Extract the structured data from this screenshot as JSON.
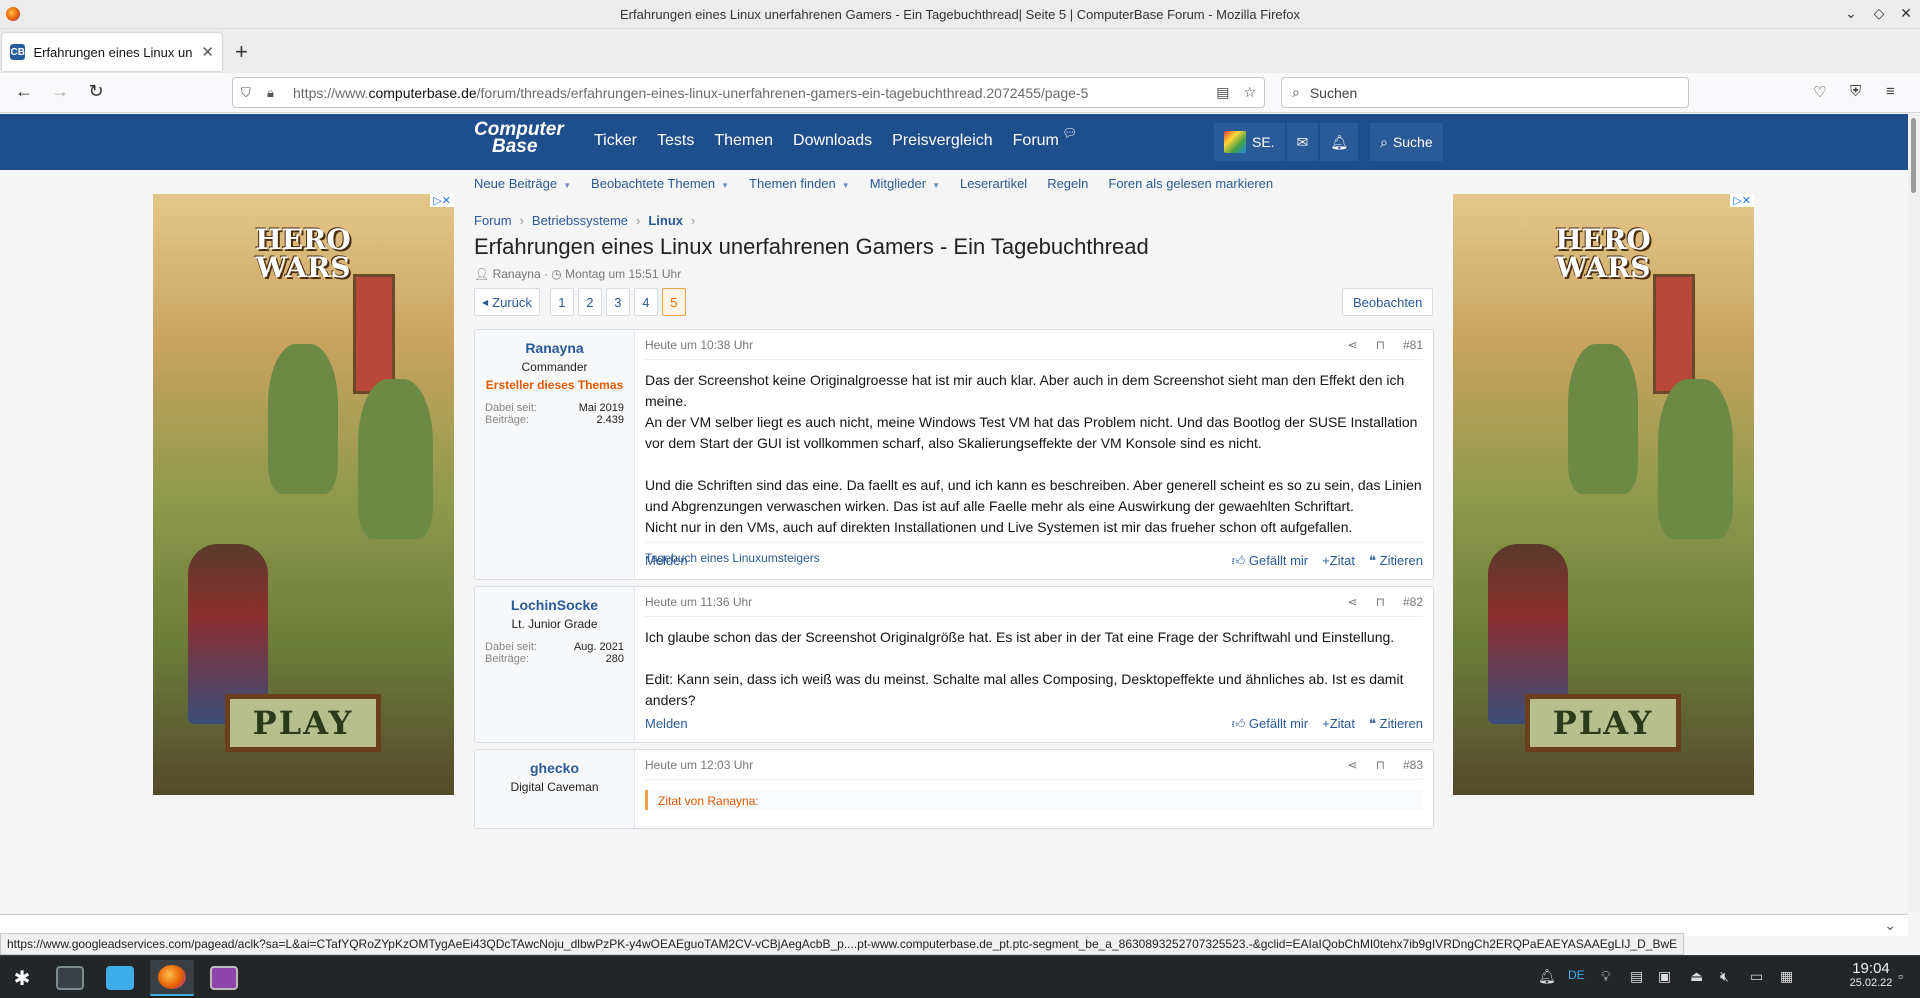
{
  "window": {
    "title": "Erfahrungen eines Linux unerfahrenen Gamers - Ein Tagebuchthread| Seite 5 | ComputerBase Forum - Mozilla Firefox",
    "controls": [
      "⌄",
      "◇",
      "✕"
    ]
  },
  "tab": {
    "label": "Erfahrungen eines Linux un",
    "favicon": "CB"
  },
  "nav": {
    "url_prefix": "https://www.",
    "url_host": "computerbase.de",
    "url_path": "/forum/threads/erfahrungen-eines-linux-unerfahrenen-gamers-ein-tagebuchthread.2072455/page-5",
    "search_placeholder": "Suchen"
  },
  "site": {
    "logo_line1": "Computer",
    "logo_line2": "Base",
    "main_nav": [
      "Ticker",
      "Tests",
      "Themen",
      "Downloads",
      "Preisvergleich",
      "Forum"
    ],
    "user_short": "SE.",
    "search_label": "Suche",
    "sub_nav": [
      {
        "label": "Neue Beiträge",
        "dropdown": true
      },
      {
        "label": "Beobachtete Themen",
        "dropdown": true
      },
      {
        "label": "Themen finden",
        "dropdown": true
      },
      {
        "label": "Mitglieder",
        "dropdown": true
      },
      {
        "label": "Leserartikel",
        "dropdown": false
      },
      {
        "label": "Regeln",
        "dropdown": false
      },
      {
        "label": "Foren als gelesen markieren",
        "dropdown": false
      }
    ]
  },
  "ad": {
    "title_line1": "HERO",
    "title_line2": "WARS",
    "cta": "PLAY"
  },
  "breadcrumb": [
    "Forum",
    "Betriebssysteme",
    "Linux"
  ],
  "thread": {
    "title": "Erfahrungen eines Linux unerfahrenen Gamers - Ein Tagebuchthread",
    "author": "Ranayna",
    "date": "Montag um 15:51 Uhr",
    "back_label": "Zurück",
    "pages": [
      "1",
      "2",
      "3",
      "4",
      "5"
    ],
    "current_page": "5",
    "watch_label": "Beobachten"
  },
  "posts": [
    {
      "user": "Ranayna",
      "rank": "Commander",
      "starter_label": "Ersteller dieses Themas",
      "joined_label": "Dabei seit:",
      "joined": "Mai 2019",
      "posts_label": "Beiträge:",
      "post_count": "2.439",
      "time": "Heute um 10:38 Uhr",
      "number": "#81",
      "paragraphs": [
        "Das der Screenshot keine Originalgroesse hat ist mir auch klar. Aber auch in dem Screenshot sieht man den Effekt den ich meine.\nAn der VM selber liegt es auch nicht, meine Windows Test VM hat das Problem nicht. Und das Bootlog der SUSE Installation vor dem Start der GUI ist vollkommen scharf, also Skalierungseffekte der VM Konsole sind es nicht.",
        "Und die Schriften sind das eine. Da faellt es auf, und ich kann es beschreiben. Aber generell scheint es so zu sein, das Linien und Abgrenzungen verwaschen wirken. Das ist auf alle Faelle mehr als eine Auswirkung der gewaehlten Schriftart.\nNicht nur in den VMs, auch auf direkten Installationen und Live Systemen ist mir das frueher schon oft aufgefallen."
      ],
      "signature": "Tagebuch eines Linuxumsteigers"
    },
    {
      "user": "LochinSocke",
      "rank": "Lt. Junior Grade",
      "joined_label": "Dabei seit:",
      "joined": "Aug. 2021",
      "posts_label": "Beiträge:",
      "post_count": "280",
      "time": "Heute um 11:36 Uhr",
      "number": "#82",
      "paragraphs": [
        "Ich glaube schon das der Screenshot Originalgröße hat. Es ist aber in der Tat eine Frage der Schriftwahl und Einstellung.",
        "Edit: Kann sein, dass ich weiß was du meinst. Schalte mal alles Composing, Desktopeffekte und ähnliches ab. Ist es damit anders?"
      ]
    },
    {
      "user": "ghecko",
      "rank": "Digital Caveman",
      "time": "Heute um 12:03 Uhr",
      "number": "#83",
      "quote_label": "Zitat von Ranayna:"
    }
  ],
  "post_actions": {
    "report": "Melden",
    "like": "Gefällt mir",
    "add_quote": "Zitat",
    "quote": "Zitieren"
  },
  "statusbar": "https://www.googleadservices.com/pagead/aclk?sa=L&ai=CTafYQRoZYpKzOMTygAeEi43QDcTAwcNoju_dlbwPzPK-y4wOEAEguoTAM2CV-vCBjAegAcbB_p....pt-www.computerbase.de_pt.ptc-segment_be_a_8630893252707325523.-&gclid=EAIaIQobChMI0tehx7ib9gIVRDngCh2ERQPaEAEYASAAEgLIJ_D_BwE",
  "taskbar": {
    "lang": "DE",
    "time": "19:04",
    "date": "25.02.22"
  }
}
